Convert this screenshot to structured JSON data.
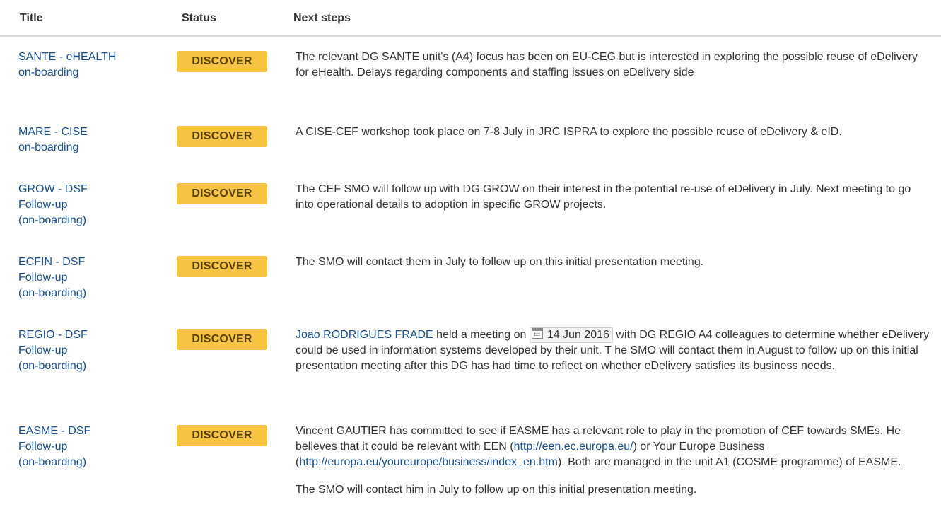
{
  "header": {
    "title": "Title",
    "status": "Status",
    "next_steps": "Next steps"
  },
  "rows": [
    {
      "title_lines": [
        "SANTE - eHEALTH",
        "on-boarding"
      ],
      "status": "DISCOVER",
      "steps": "The relevant DG SANTE unit's (A4) focus has been on EU-CEG but is interested in exploring the possible reuse of eDelivery for eHealth. Delays regarding components and staffing issues on eDelivery side"
    },
    {
      "title_lines": [
        "MARE - CISE",
        "on-boarding"
      ],
      "status": "DISCOVER",
      "steps": "A CISE-CEF workshop took place on 7-8 July in JRC ISPRA to explore the possible reuse of eDelivery & eID."
    },
    {
      "title_lines": [
        "GROW - DSF",
        "Follow-up",
        "(on-boarding)"
      ],
      "status": "DISCOVER",
      "steps": "The CEF SMO will follow up with DG GROW on their interest in the potential re-use of eDelivery in July. Next meeting to go into operational details to adoption in specific GROW projects."
    },
    {
      "title_lines": [
        "ECFIN - DSF",
        "Follow-up",
        "(on-boarding)"
      ],
      "status": "DISCOVER",
      "steps": "The SMO will contact them in July to follow up on this initial presentation meeting."
    },
    {
      "title_lines": [
        "REGIO - DSF",
        "Follow-up",
        "(on-boarding)"
      ],
      "status": "DISCOVER",
      "person": "Joao RODRIGUES FRADE",
      "text_a": " held a meeting on ",
      "date": "14 Jun 2016",
      "text_b": " with DG REGIO A4 colleagues to determine whether eDelivery could be used in information systems developed by their unit. T he SMO will contact them in August to follow up on this initial presentation meeting after this DG has had time to reflect on whether eDelivery satisfies its business needs."
    },
    {
      "title_lines": [
        "EASME - DSF",
        "Follow-up",
        "(on-boarding)"
      ],
      "status": "DISCOVER",
      "p1_a": "Vincent GAUTIER has committed to see if EASME has a relevant role to play in the promotion of CEF towards SMEs. He believes that it could be relevant with EEN (",
      "link1": "http://een.ec.europa.eu/",
      "p1_b": ") or Your Europe Business (",
      "link2": "http://europa.eu/youreurope/business/index_en.htm",
      "p1_c": "). Both are managed in the unit A1 (COSME programme) of EASME.",
      "p2": "The SMO will contact him in July to follow up on this initial presentation meeting."
    }
  ]
}
